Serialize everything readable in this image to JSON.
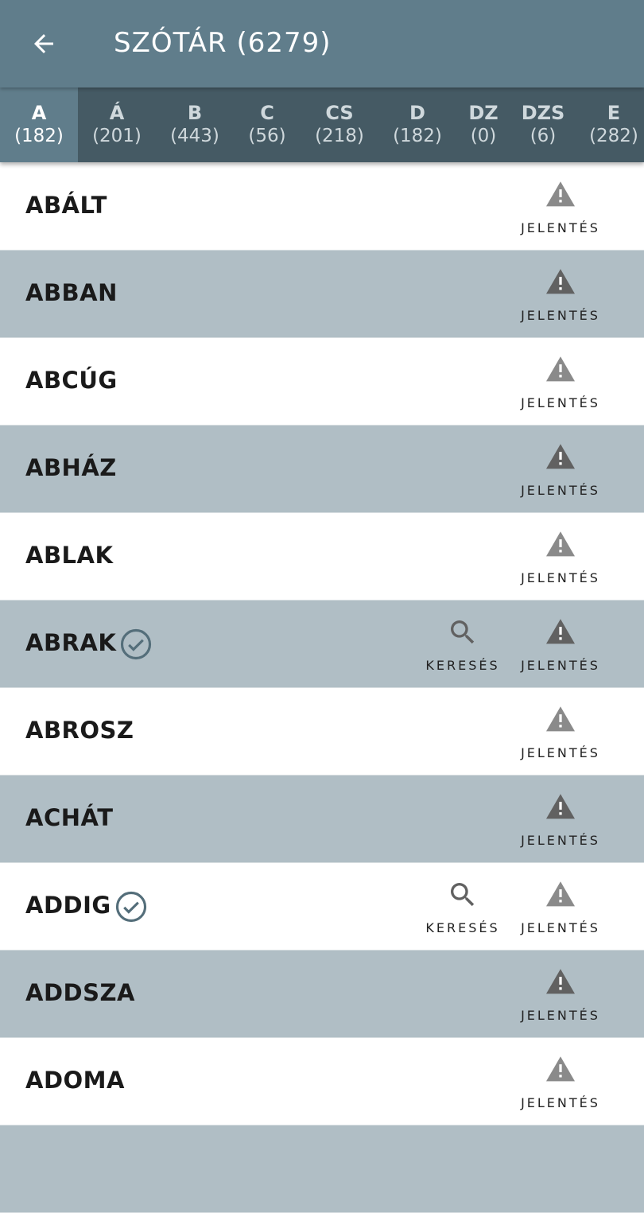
{
  "appbar": {
    "title": "SZÓTÁR (6279)",
    "back_icon": "arrow-left-icon"
  },
  "tabs": [
    {
      "letter": "A",
      "count": "(182)",
      "active": true
    },
    {
      "letter": "Á",
      "count": "(201)",
      "active": false
    },
    {
      "letter": "B",
      "count": "(443)",
      "active": false
    },
    {
      "letter": "C",
      "count": "(56)",
      "active": false
    },
    {
      "letter": "CS",
      "count": "(218)",
      "active": false
    },
    {
      "letter": "D",
      "count": "(182)",
      "active": false
    },
    {
      "letter": "DZ",
      "count": "(0)",
      "active": false
    },
    {
      "letter": "DZS",
      "count": "(6)",
      "active": false
    },
    {
      "letter": "E",
      "count": "(282)",
      "active": false
    }
  ],
  "labels": {
    "report": "JELENTÉS",
    "search": "KERESÉS"
  },
  "words": [
    {
      "word": "ABÁLT",
      "found": false
    },
    {
      "word": "ABBAN",
      "found": false
    },
    {
      "word": "ABCÚG",
      "found": false
    },
    {
      "word": "ABHÁZ",
      "found": false
    },
    {
      "word": "ABLAK",
      "found": false
    },
    {
      "word": "ABRAK",
      "found": true
    },
    {
      "word": "ABROSZ",
      "found": false
    },
    {
      "word": "ACHÁT",
      "found": false
    },
    {
      "word": "ADDIG",
      "found": true
    },
    {
      "word": "ADDSZA",
      "found": false
    },
    {
      "word": "ADOMA",
      "found": false
    },
    {
      "word": "",
      "found": false
    }
  ],
  "colors": {
    "appbar": "#607d8b",
    "tabbar": "#455a64",
    "row_shaded": "#b0bec5",
    "check": "#546e7a"
  }
}
